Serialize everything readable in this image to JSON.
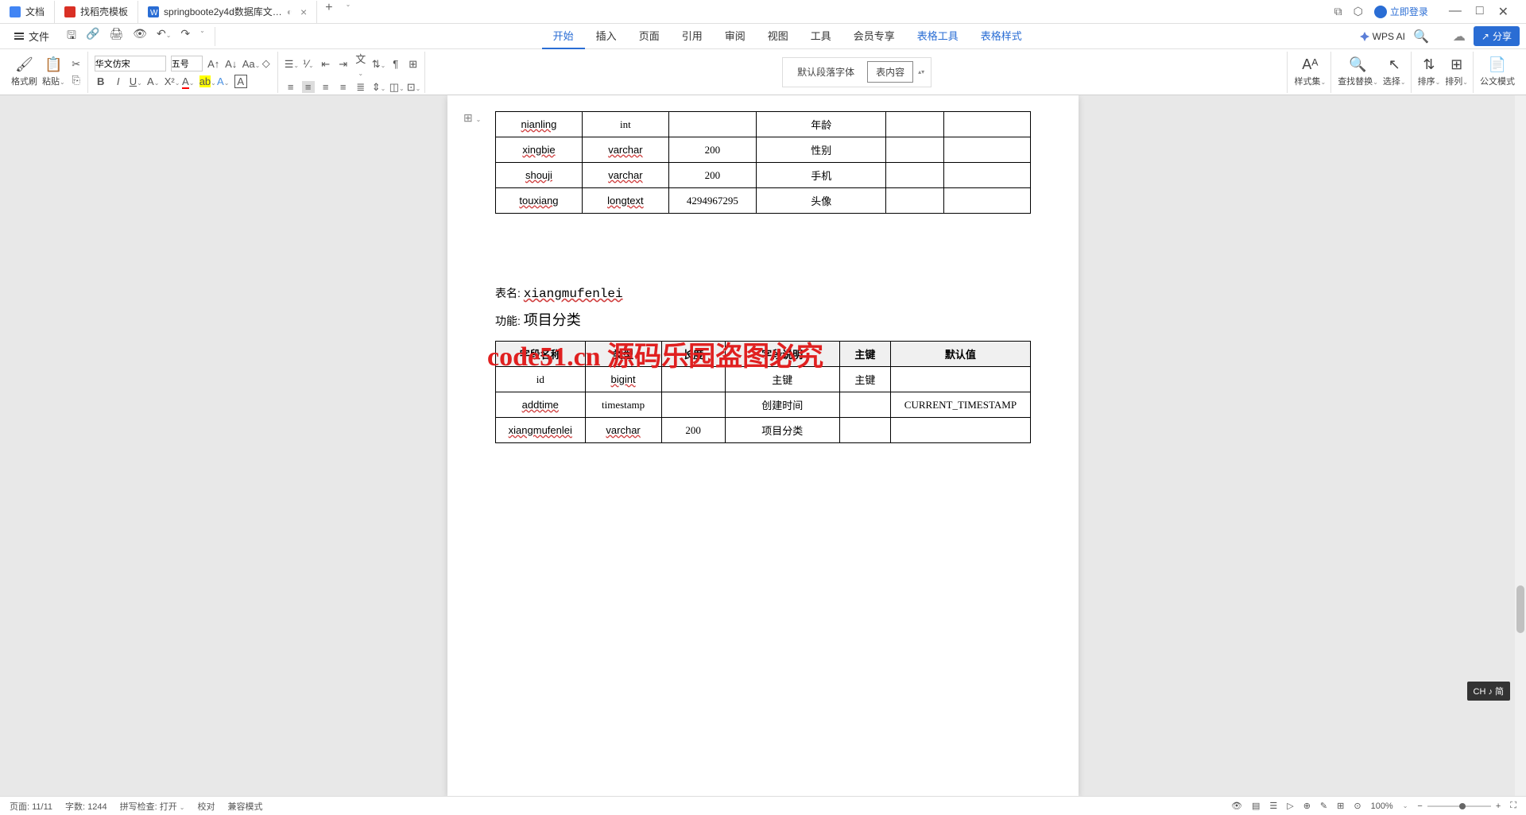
{
  "tabs": [
    {
      "icon_color": "#4285f4",
      "label": "文档"
    },
    {
      "icon_color": "#d93025",
      "label": "找稻壳模板"
    },
    {
      "icon_color": "#2a6dd4",
      "label": "springboote2y4d数据库文…"
    }
  ],
  "login_text": "立即登录",
  "file_menu": "文件",
  "menu_items": [
    "开始",
    "插入",
    "页面",
    "引用",
    "审阅",
    "视图",
    "工具",
    "会员专享",
    "表格工具",
    "表格样式"
  ],
  "wps_ai_label": "WPS AI",
  "share_label": "分享",
  "font_name": "华文仿宋",
  "font_size": "五号",
  "ribbon": {
    "format_paint": "格式刷",
    "paste": "粘贴",
    "style_default": "默认段落字体",
    "style_content": "表内容",
    "style_set": "样式集",
    "find_replace": "查找替换",
    "select": "选择",
    "sort": "排序",
    "arrange": "排列",
    "doc_mode": "公文模式"
  },
  "table1": {
    "rows": [
      {
        "field": "nianling",
        "type": "int",
        "len": "",
        "desc": "年龄"
      },
      {
        "field": "xingbie",
        "type": "varchar",
        "len": "200",
        "desc": "性别"
      },
      {
        "field": "shouji",
        "type": "varchar",
        "len": "200",
        "desc": "手机"
      },
      {
        "field": "touxiang",
        "type": "longtext",
        "len": "4294967295",
        "desc": "头像"
      }
    ]
  },
  "table2_meta": {
    "name_label": "表名:",
    "name_value": "xiangmufenlei",
    "func_label": "功能:",
    "func_value": "项目分类"
  },
  "table2": {
    "headers": [
      "字段名称",
      "类型",
      "长度",
      "字段说明",
      "主键",
      "默认值"
    ],
    "rows": [
      {
        "field": "id",
        "type": "bigint",
        "len": "",
        "desc": "主键",
        "pk": "主键",
        "default": ""
      },
      {
        "field": "addtime",
        "type": "timestamp",
        "len": "",
        "desc": "创建时间",
        "pk": "",
        "default": "CURRENT_TIMESTAMP"
      },
      {
        "field": "xiangmufenlei",
        "type": "varchar",
        "len": "200",
        "desc": "项目分类",
        "pk": "",
        "default": ""
      }
    ]
  },
  "watermark": "code51.cn 源码乐园盗图必究",
  "ime": "CH ♪ 简",
  "status": {
    "page": "页面: 11/11",
    "words": "字数: 1244",
    "spell": "拼写检查: 打开",
    "proof": "校对",
    "compat": "兼容模式",
    "zoom": "100%"
  }
}
